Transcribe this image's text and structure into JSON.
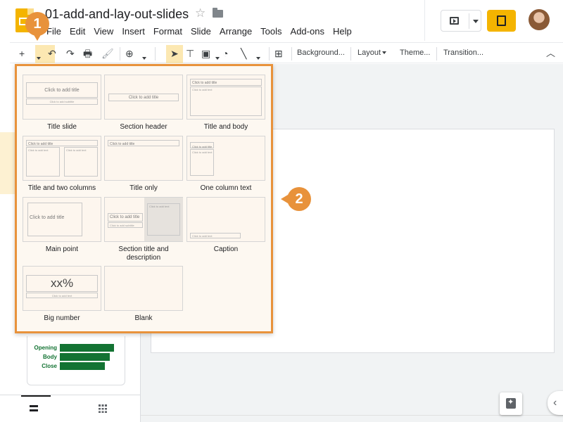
{
  "app": {
    "doc_title": "01-add-and-lay-out-slides"
  },
  "menu": [
    "File",
    "Edit",
    "View",
    "Insert",
    "Format",
    "Slide",
    "Arrange",
    "Tools",
    "Add-ons",
    "Help"
  ],
  "toolbar": {
    "background_label": "Background...",
    "layout_label": "Layout",
    "theme_label": "Theme...",
    "transition_label": "Transition..."
  },
  "layout_panel": {
    "items": [
      {
        "label": "Title slide",
        "title_text": "Click to add title",
        "subtitle_text": "Click to add subtitle"
      },
      {
        "label": "Section header",
        "title_text": "Click to add title"
      },
      {
        "label": "Title and body",
        "title_text": "Click to add title",
        "body_text": "Click to add text"
      },
      {
        "label": "Title and two columns",
        "title_text": "Click to add title",
        "body_text": "Click to add text",
        "body2_text": "Click to add text"
      },
      {
        "label": "Title only",
        "title_text": "Click to add title"
      },
      {
        "label": "One column text",
        "title_text": "Click to add title",
        "body_text": "Click to add text"
      },
      {
        "label": "Main point",
        "title_text": "Click to add title"
      },
      {
        "label": "Section title and description",
        "title_text": "Click to add title",
        "subtitle_text": "Click to add subtitle",
        "body_text": "Click to add text"
      },
      {
        "label": "Caption",
        "body_text": "Click to add text"
      },
      {
        "label": "Big number",
        "title_text": "xx%",
        "body_text": "Click to add text"
      },
      {
        "label": "Blank"
      }
    ]
  },
  "filmstrip": {
    "thumbnail_rows": [
      {
        "label": "Opening"
      },
      {
        "label": "Body"
      },
      {
        "label": "Close"
      }
    ]
  },
  "callouts": {
    "step1": "1",
    "step2": "2"
  },
  "colors": {
    "accent": "#e8923b",
    "brand": "#f4b400",
    "thumb_green": "#137333"
  }
}
